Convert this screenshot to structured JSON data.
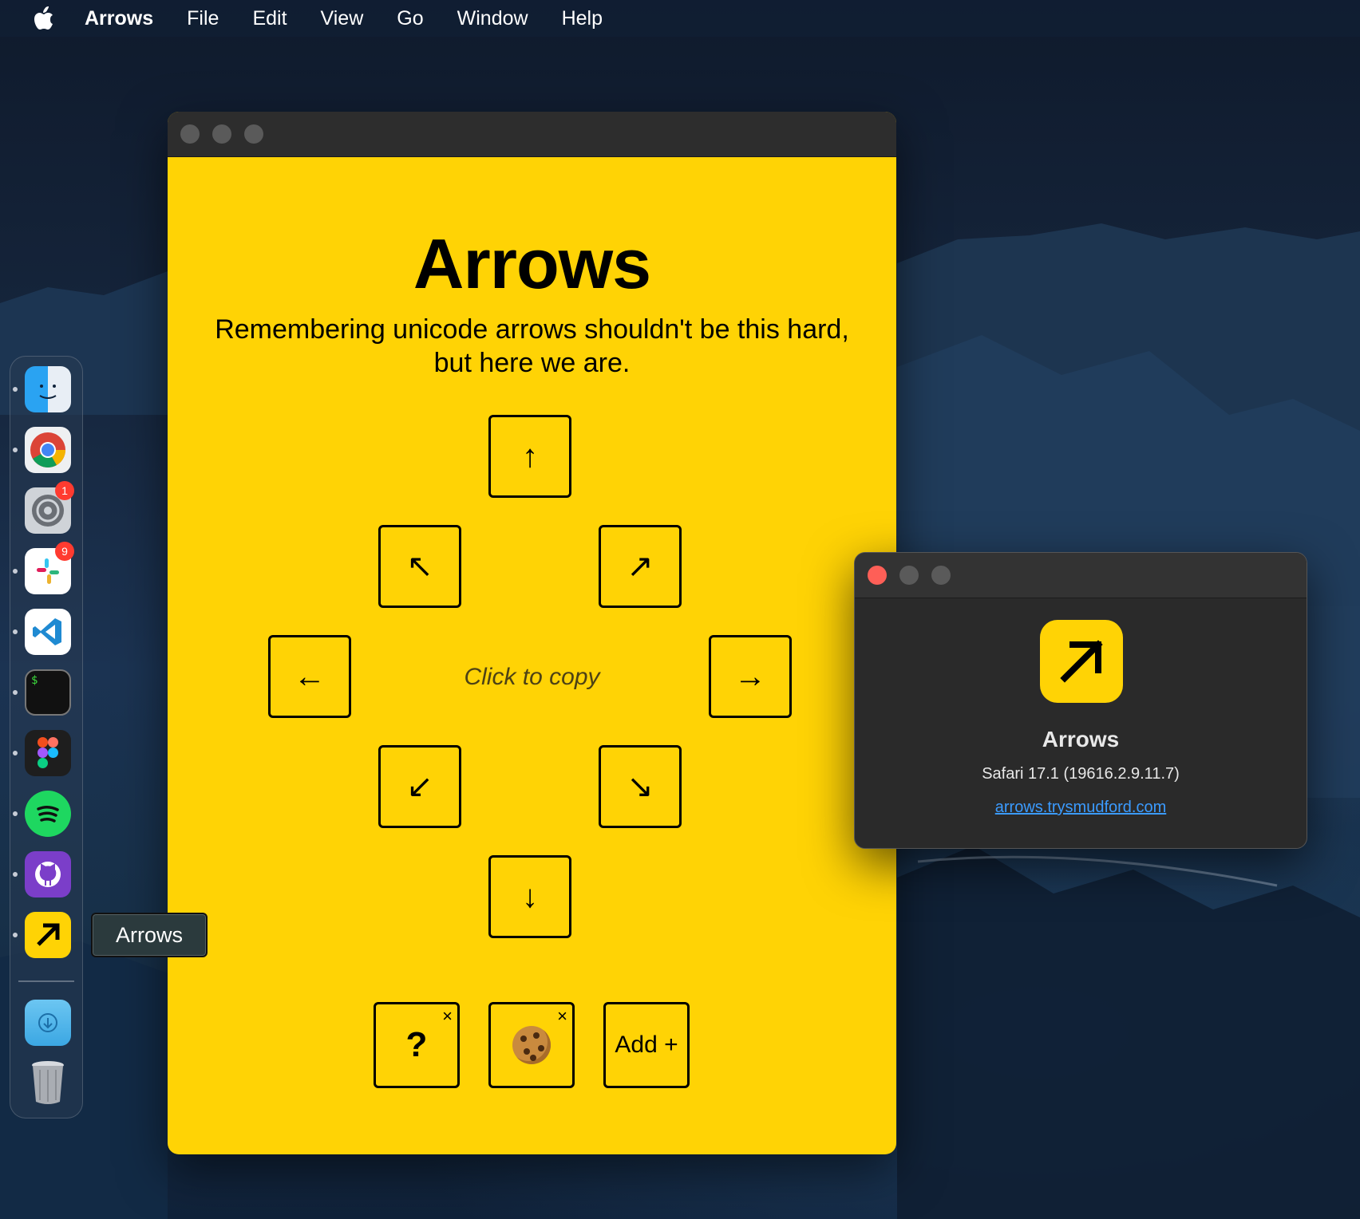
{
  "menubar": {
    "app_name": "Arrows",
    "items": [
      "File",
      "Edit",
      "View",
      "Go",
      "Window",
      "Help"
    ]
  },
  "main_window": {
    "title": "Arrows",
    "tagline_line1": "Remembering unicode arrows shouldn't be this hard,",
    "tagline_line2": "but here we are.",
    "hint": "Click to copy",
    "arrows": {
      "up": "↑",
      "up_left": "↖",
      "up_right": "↗",
      "left": "←",
      "right": "→",
      "down_left": "↙",
      "down_right": "↘",
      "down": "↓"
    },
    "custom": {
      "question": "?",
      "remove": "×",
      "add_label": "Add +"
    },
    "accent_color": "#ffd305"
  },
  "about_window": {
    "app_name": "Arrows",
    "version": "Safari 17.1 (19616.2.9.11.7)",
    "link": "arrows.trysmudford.com"
  },
  "dock": {
    "items": [
      "finder-icon",
      "chrome-icon",
      "system-settings-icon",
      "slack-icon",
      "vscode-icon",
      "terminal-icon",
      "figma-icon",
      "spotify-icon",
      "github-desktop-icon",
      "arrows-app-icon",
      "downloads-folder-icon",
      "trash-icon"
    ],
    "badges": {
      "system_settings": "1",
      "slack": "9"
    },
    "tooltip": "Arrows"
  }
}
